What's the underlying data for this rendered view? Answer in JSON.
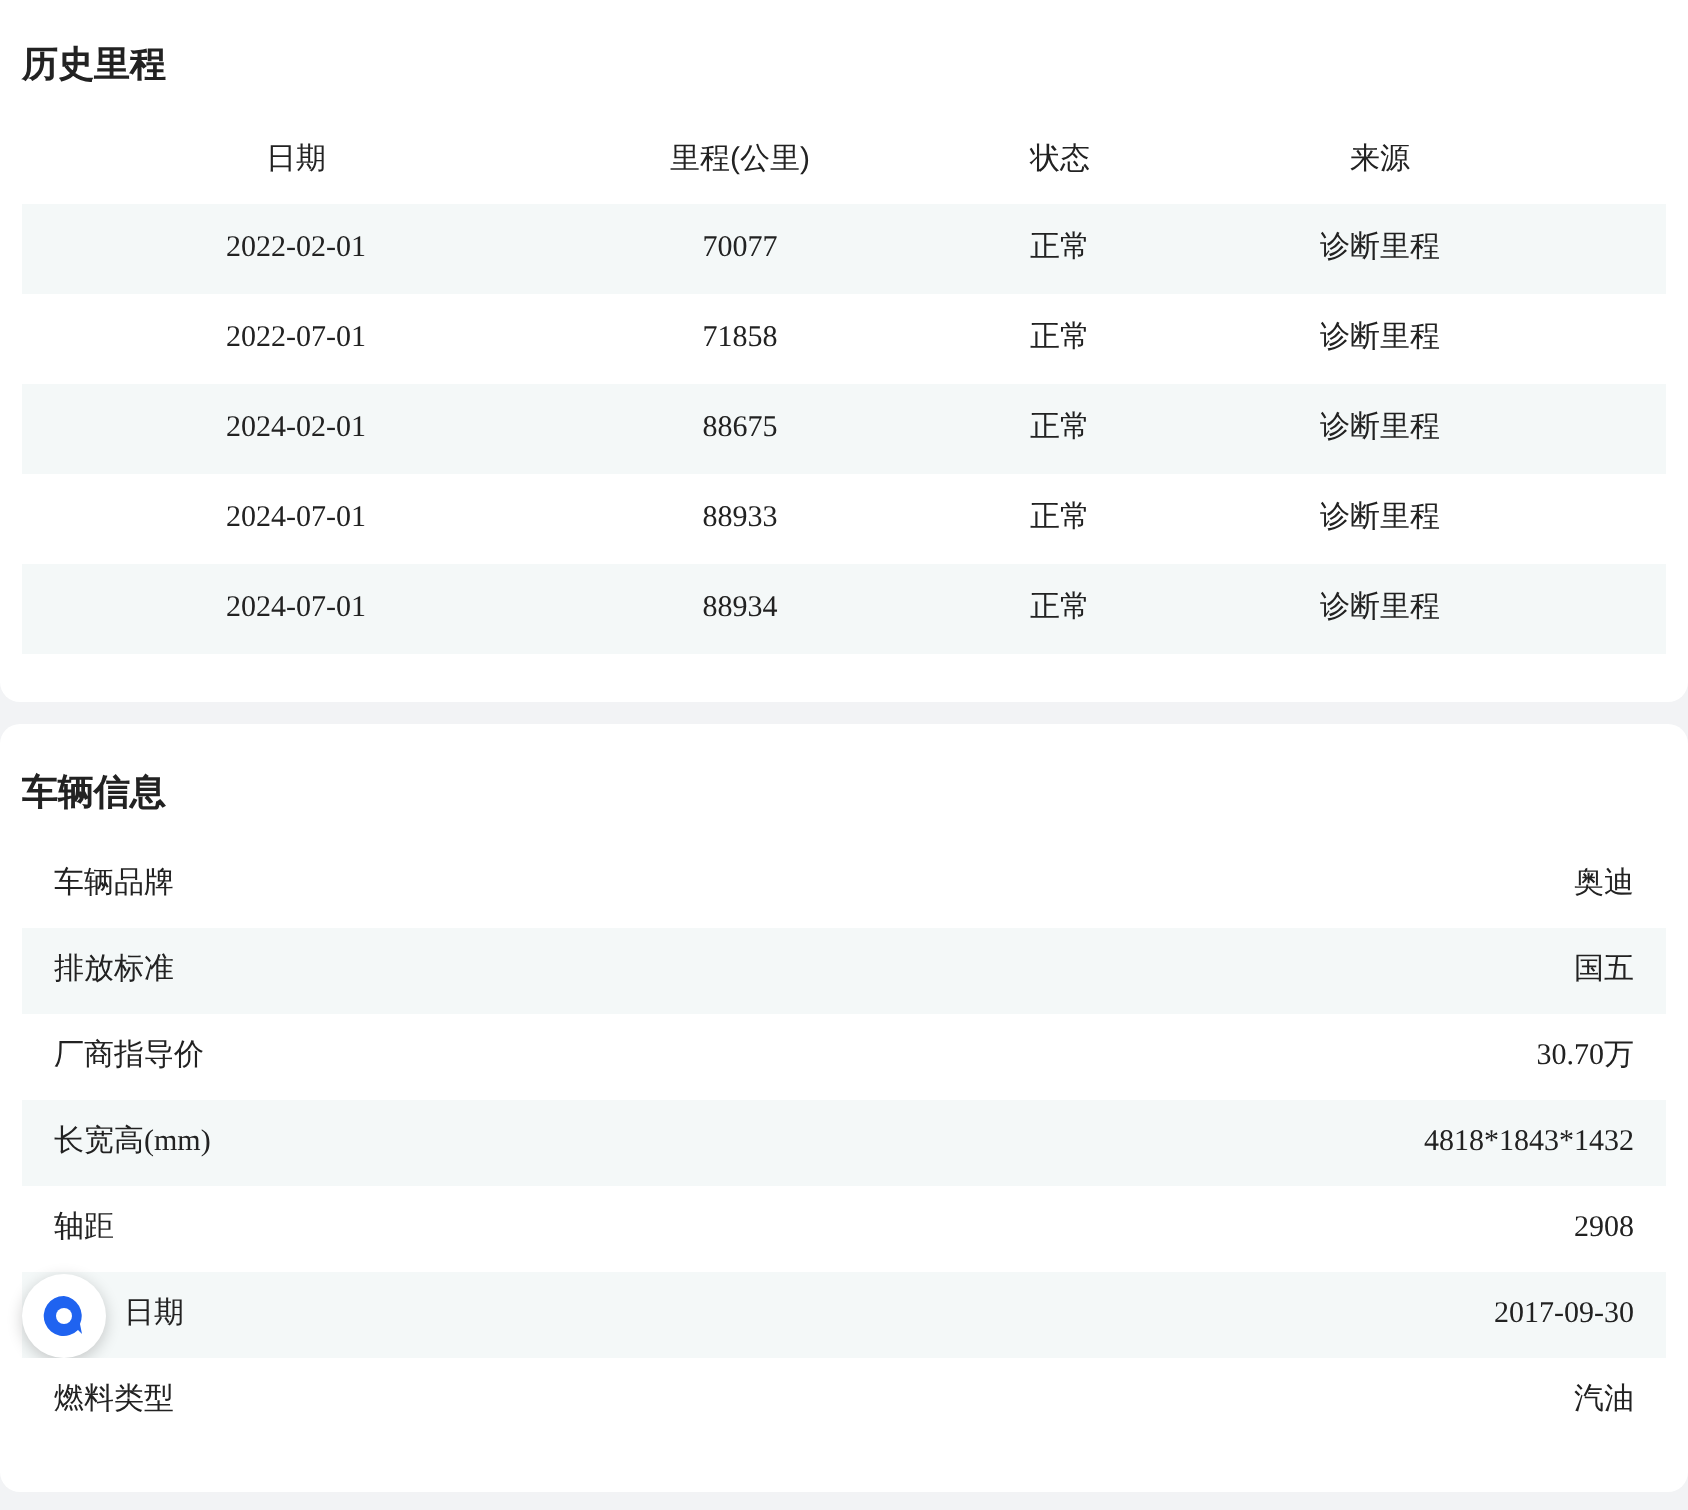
{
  "history": {
    "title": "历史里程",
    "columns": [
      "日期",
      "里程(公里)",
      "状态",
      "来源"
    ],
    "rows": [
      [
        "2022-02-01",
        "70077",
        "正常",
        "诊断里程"
      ],
      [
        "2022-07-01",
        "71858",
        "正常",
        "诊断里程"
      ],
      [
        "2024-02-01",
        "88675",
        "正常",
        "诊断里程"
      ],
      [
        "2024-07-01",
        "88933",
        "正常",
        "诊断里程"
      ],
      [
        "2024-07-01",
        "88934",
        "正常",
        "诊断里程"
      ]
    ]
  },
  "vehicle": {
    "title": "车辆信息",
    "rows": [
      {
        "label": "车辆品牌",
        "value": "奥迪"
      },
      {
        "label": "排放标准",
        "value": "国五"
      },
      {
        "label": "厂商指导价",
        "value": "30.70万"
      },
      {
        "label": "长宽高(mm)",
        "value": "4818*1843*1432"
      },
      {
        "label": "轴距",
        "value": "2908"
      },
      {
        "label": "日期",
        "value": "2017-09-30",
        "covered": true
      },
      {
        "label": "燃料类型",
        "value": "汽油"
      }
    ]
  }
}
